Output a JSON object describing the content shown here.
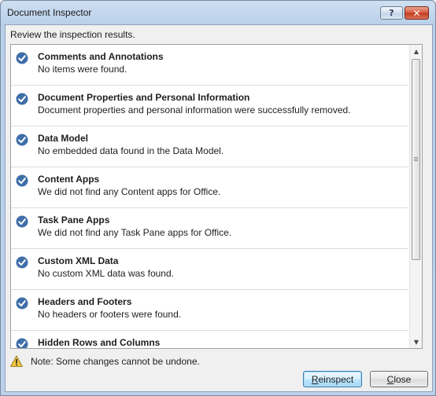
{
  "window": {
    "title": "Document Inspector",
    "help_label": "?",
    "close_label": "✕"
  },
  "subtitle": "Review the inspection results.",
  "results": [
    {
      "title": "Comments and Annotations",
      "description": "No items were found.",
      "icon": "check-circle-icon"
    },
    {
      "title": "Document Properties and Personal Information",
      "description": "Document properties and personal information were successfully removed.",
      "icon": "check-circle-icon"
    },
    {
      "title": "Data Model",
      "description": "No embedded data found in the Data Model.",
      "icon": "check-circle-icon"
    },
    {
      "title": "Content Apps",
      "description": "We did not find any Content apps for Office.",
      "icon": "check-circle-icon"
    },
    {
      "title": "Task Pane Apps",
      "description": "We did not find any Task Pane apps for Office.",
      "icon": "check-circle-icon"
    },
    {
      "title": "Custom XML Data",
      "description": "No custom XML data was found.",
      "icon": "check-circle-icon"
    },
    {
      "title": "Headers and Footers",
      "description": "No headers or footers were found.",
      "icon": "check-circle-icon"
    },
    {
      "title": "Hidden Rows and Columns",
      "description": "",
      "icon": "check-circle-icon"
    }
  ],
  "note": {
    "icon": "warning-icon",
    "text": "Note: Some changes cannot be undone."
  },
  "buttons": {
    "reinspect": "Reinspect",
    "reinspect_mnemonic": "R",
    "reinspect_rest": "einspect",
    "close": "Close",
    "close_mnemonic": "C",
    "close_rest": "lose"
  },
  "colors": {
    "check_fill": "#3f6ea8",
    "warning_fill": "#f0c43c"
  }
}
